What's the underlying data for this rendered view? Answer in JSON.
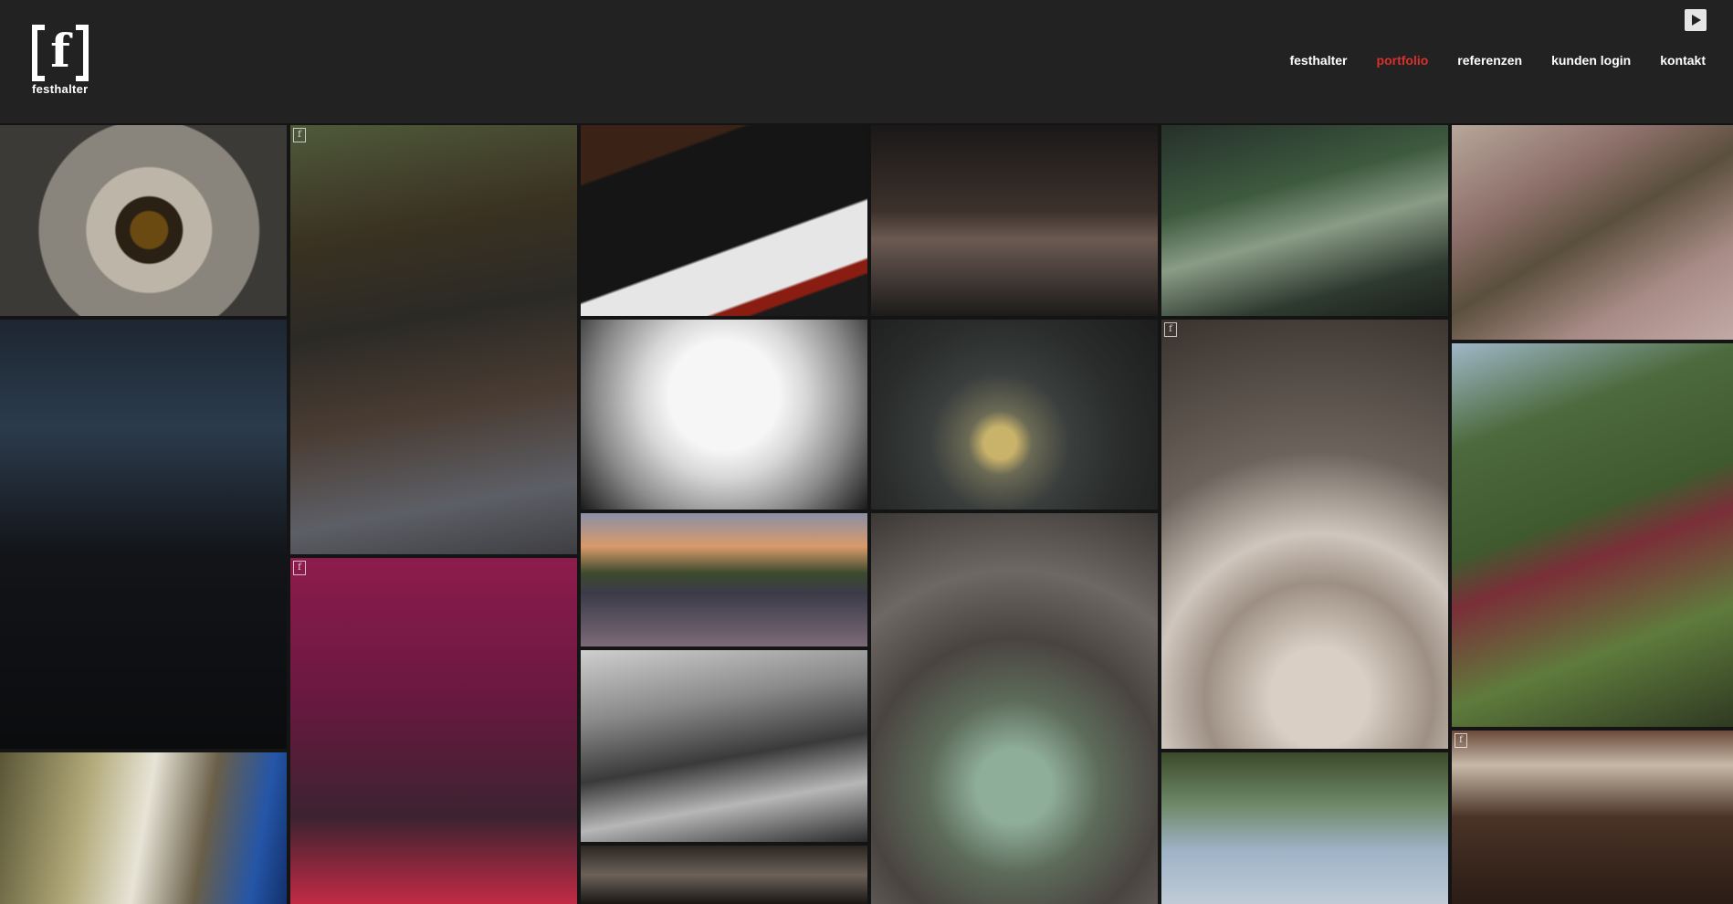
{
  "brand": {
    "letter": "f",
    "name": "festhalter"
  },
  "nav": [
    {
      "label": "festhalter",
      "active": false
    },
    {
      "label": "portfolio",
      "active": true
    },
    {
      "label": "referenzen",
      "active": false
    },
    {
      "label": "kunden login",
      "active": false
    },
    {
      "label": "kontakt",
      "active": false
    }
  ],
  "colors": {
    "header_bg": "#222222",
    "accent": "#d9302b",
    "grid_bg": "#141414"
  },
  "icons": {
    "play": "play-icon",
    "badge": "festhalter-badge-icon"
  },
  "gallery": [
    {
      "subject": "spiral-staircase-top-view",
      "badge": false
    },
    {
      "subject": "abandoned-room-ballerina",
      "badge": true
    },
    {
      "subject": "organ-stops-keyboard",
      "badge": false
    },
    {
      "subject": "tattoo-machines",
      "badge": false
    },
    {
      "subject": "old-wine-bottles",
      "badge": false
    },
    {
      "subject": "drawer-with-money",
      "badge": false
    },
    {
      "subject": "chrysler-building-night",
      "badge": false
    },
    {
      "subject": "concert-duo-backlit",
      "badge": false
    },
    {
      "subject": "perfume-bottles-flower",
      "badge": false
    },
    {
      "subject": "spiral-staircase-white",
      "badge": true
    },
    {
      "subject": "tuk-tuk-green",
      "badge": false
    },
    {
      "subject": "festival-crowd",
      "badge": false
    },
    {
      "subject": "singer-sequin-hood",
      "badge": true
    },
    {
      "subject": "sneakers-display",
      "badge": false
    },
    {
      "subject": "green-bottles-frangipani",
      "badge": false
    },
    {
      "subject": "subway-station",
      "badge": false
    },
    {
      "subject": "trees-sky",
      "badge": false
    },
    {
      "subject": "woman-in-attic",
      "badge": true
    },
    {
      "subject": "industrial-roof",
      "badge": false
    }
  ],
  "badge_letter": "f"
}
